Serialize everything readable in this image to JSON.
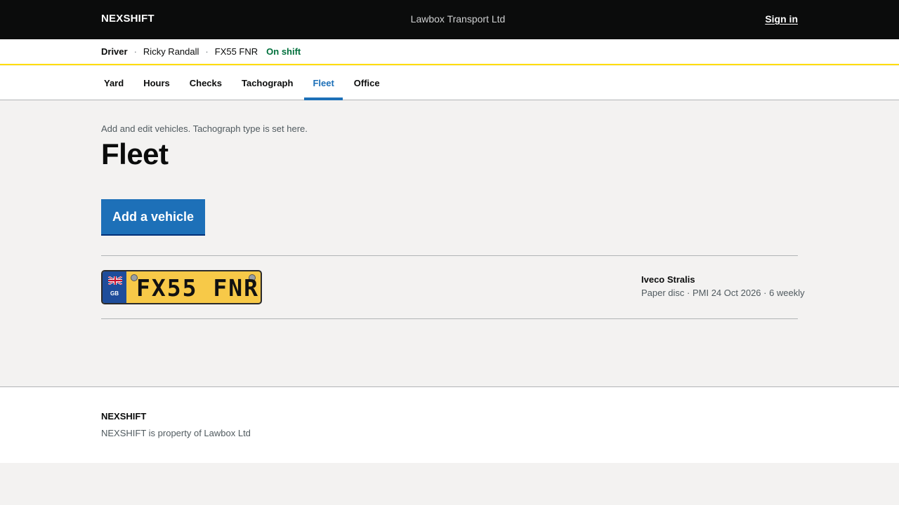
{
  "header": {
    "brand": "NEXSHIFT",
    "organisation": "Lawbox Transport Ltd",
    "sign_in": "Sign in"
  },
  "driver_bar": {
    "role": "Driver",
    "separator": "·",
    "name": "Ricky Randall",
    "vehicle": "FX55 FNR",
    "status": "On shift",
    "status_color": "#00703c"
  },
  "nav": {
    "tabs": [
      {
        "label": "Yard"
      },
      {
        "label": "Hours"
      },
      {
        "label": "Checks"
      },
      {
        "label": "Tachograph"
      },
      {
        "label": "Fleet"
      },
      {
        "label": "Office"
      }
    ],
    "active": "Fleet",
    "accent": "#1d70b8"
  },
  "main": {
    "caption": "Add and edit vehicles. Tachograph type is set here.",
    "title": "Fleet",
    "add_button": "Add a vehicle"
  },
  "vehicles": [
    {
      "registration": "FX55 FNR",
      "plate_country": "GB",
      "plate_flag": "union-flag-icon",
      "plate_color": "#f7c948",
      "model": "Iveco Stralis",
      "details": "Paper disc · PMI 24 Oct 2026 · 6 weekly"
    }
  ],
  "footer": {
    "brand": "NEXSHIFT",
    "note": "NEXSHIFT is property of Lawbox Ltd"
  }
}
